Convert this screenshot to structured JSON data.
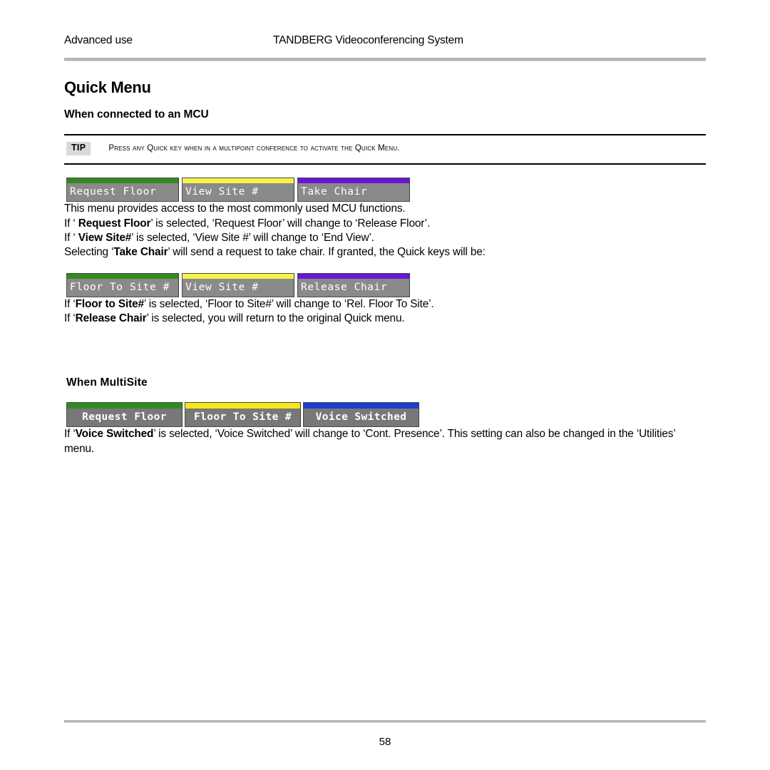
{
  "header": {
    "left": "Advanced use",
    "center": "TANDBERG Videoconferencing System"
  },
  "title": "Quick Menu",
  "subtitle": "When connected to an MCU",
  "tip": {
    "badge": "TIP",
    "text": "Press any Quick key when in a multipoint conference to activate the Quick Menu."
  },
  "menubars": [
    {
      "name": "mcu-quick-keys",
      "keys": [
        {
          "label": "Request Floor",
          "accent": "#2f8b1f"
        },
        {
          "label": "View Site #",
          "accent": "#f7f447"
        },
        {
          "label": "Take Chair",
          "accent": "#6a16d8"
        }
      ]
    },
    {
      "name": "chair-quick-keys",
      "keys": [
        {
          "label": "Floor To Site #",
          "accent": "#2f8b1f"
        },
        {
          "label": "View Site #",
          "accent": "#f7f447"
        },
        {
          "label": "Release Chair",
          "accent": "#6a16d8"
        }
      ]
    },
    {
      "name": "multisite-quick-keys",
      "keys": [
        {
          "label": "Request Floor",
          "accent": "#2f8b1f"
        },
        {
          "label": "Floor To Site #",
          "accent": "#f2e81b"
        },
        {
          "label": "Voice Switched",
          "accent": "#1a3fd0"
        }
      ]
    }
  ],
  "paragraphs": {
    "intro": "This menu provides access to the most commonly used MCU functions.",
    "request_floor_pre": "If ‘ ",
    "request_floor_bold": "Request Floor",
    "request_floor_post": "’ is selected, ‘Request Floor’ will change to ‘Release Floor’.",
    "view_site_pre": "If ‘ ",
    "view_site_bold": "View Site#",
    "view_site_post": "’ is selected, ‘View Site #’ will change to ‘End View’.",
    "take_chair_pre": "Selecting ‘",
    "take_chair_bold": "Take Chair",
    "take_chair_post": "’ will send a request to take chair. If granted, the Quick keys will be:",
    "floor_to_site_pre": "If ‘",
    "floor_to_site_bold": "Floor to Site#",
    "floor_to_site_post": "’ is selected, ‘Floor to Site#’ will change to ‘Rel. Floor To Site’.",
    "release_chair_pre": "If ‘",
    "release_chair_bold": "Release Chair",
    "release_chair_post": "’ is selected, you will return to the original Quick menu.",
    "voice_switched_pre": "If ‘",
    "voice_switched_bold": "Voice Switched",
    "voice_switched_post": "’ is selected, ‘Voice Switched’ will change to ‘Cont. Presence’. This setting can also be changed in the ‘Utilities’ menu."
  },
  "multisite_heading": "When MultiSite",
  "footer": {
    "page_number": "58"
  }
}
